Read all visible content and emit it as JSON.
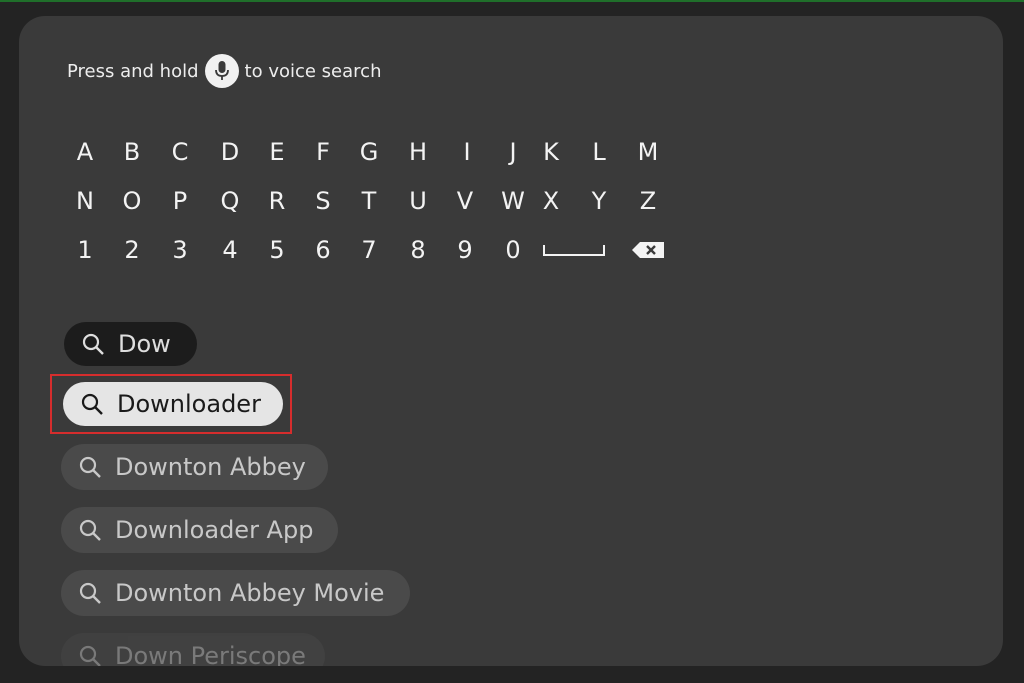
{
  "voice_hint": {
    "before": "Press and hold",
    "after": "to voice search",
    "icon": "microphone-icon"
  },
  "keyboard": {
    "rows": [
      [
        "A",
        "B",
        "C",
        "D",
        "E",
        "F",
        "G",
        "H",
        "I",
        "J",
        "K",
        "L",
        "M"
      ],
      [
        "N",
        "O",
        "P",
        "Q",
        "R",
        "S",
        "T",
        "U",
        "V",
        "W",
        "X",
        "Y",
        "Z"
      ],
      [
        "1",
        "2",
        "3",
        "4",
        "5",
        "6",
        "7",
        "8",
        "9",
        "0"
      ]
    ],
    "special_keys": [
      "space-key-icon",
      "backspace-icon"
    ]
  },
  "suggestions": {
    "query": "Dow",
    "items": [
      {
        "label": "Downloader",
        "state": "selected"
      },
      {
        "label": "Downton Abbey",
        "state": "normal"
      },
      {
        "label": "Downloader App",
        "state": "normal"
      },
      {
        "label": "Downton Abbey Movie",
        "state": "normal"
      },
      {
        "label": "Down Periscope",
        "state": "faded"
      }
    ]
  },
  "colors": {
    "panel": "#3a3a3a",
    "highlight_border": "#d62d2d",
    "selected_pill": "#e5e5e5"
  }
}
